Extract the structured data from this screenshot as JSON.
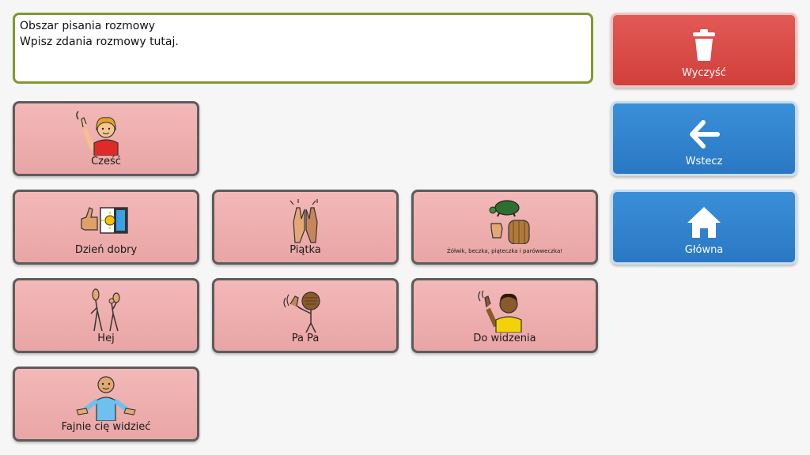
{
  "message_box": {
    "title": "Obszar pisania rozmowy",
    "placeholder": "Wpisz zdania rozmowy tutaj."
  },
  "tiles": [
    {
      "label": "Cześć",
      "icon": "waving-person-icon"
    },
    {
      "label": "Dzień dobry",
      "icon": "thumbs-up-sun-icon"
    },
    {
      "label": "Piątka",
      "icon": "high-five-hands-icon"
    },
    {
      "label": "Żółwik, beczka, piąteczka i parówweczka!",
      "icon": "turtle-barrel-fist-icon"
    },
    {
      "label": "Hej",
      "icon": "two-people-waving-icon"
    },
    {
      "label": "Pa Pa",
      "icon": "waving-goodbye-icon"
    },
    {
      "label": "Do widzenia",
      "icon": "person-waving-icon"
    },
    {
      "label": "Fajnie cię widzieć",
      "icon": "welcoming-person-icon"
    }
  ],
  "controls": {
    "clear": {
      "label": "Wyczyść",
      "icon": "trash-icon",
      "color": "#d9473f"
    },
    "back": {
      "label": "Wstecz",
      "icon": "back-arrow-icon",
      "color": "#2f83cf"
    },
    "home": {
      "label": "Główna",
      "icon": "home-icon",
      "color": "#2f83cf"
    }
  }
}
